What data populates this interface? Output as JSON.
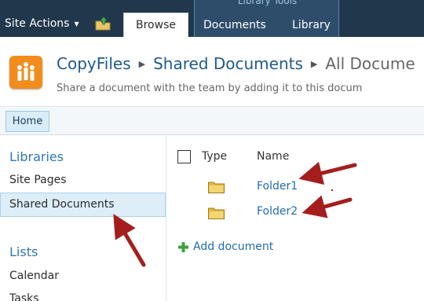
{
  "ribbon": {
    "site_actions": "Site Actions",
    "browse_tab": "Browse",
    "library_tools_title": "Library Tools",
    "documents_tab": "Documents",
    "library_tab": "Library",
    "icons": [
      "nav-up-icon",
      "chevron-down-icon"
    ]
  },
  "title_area": {
    "breadcrumb": [
      "CopyFiles",
      "Shared Documents",
      "All Docume"
    ],
    "description": "Share a document with the team by adding it to this docum",
    "logo_icon": "site-logo-icon"
  },
  "topnav": {
    "home": "Home"
  },
  "quick_launch": {
    "libraries_heading": "Libraries",
    "libraries": [
      "Site Pages",
      "Shared Documents"
    ],
    "selected": "Shared Documents",
    "lists_heading": "Lists",
    "lists": [
      "Calendar",
      "Tasks"
    ]
  },
  "list_view": {
    "columns": [
      "Type",
      "Name"
    ],
    "rows": [
      {
        "type_icon": "folder-icon",
        "name": "Folder1"
      },
      {
        "type_icon": "folder-icon",
        "name": "Folder2"
      }
    ],
    "add_document": "Add document"
  },
  "colors": {
    "ribbon": "#21374c",
    "contextual_tab": "#2e4d6b",
    "link": "#1f6cb0",
    "heading": "#2f78b7",
    "logo": "#f28c1c",
    "annotation_arrow": "#a41e1e"
  }
}
